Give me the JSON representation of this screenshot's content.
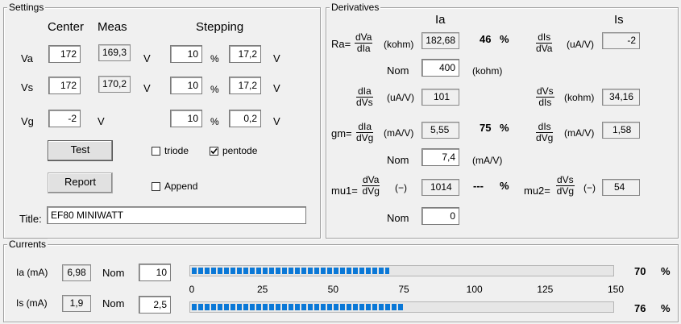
{
  "settings": {
    "legend": "Settings",
    "headers": {
      "center": "Center",
      "meas": "Meas",
      "stepping": "Stepping"
    },
    "rows": [
      {
        "label": "Va",
        "center": "172",
        "meas": "169,3",
        "unit": "V",
        "step_pct": "10",
        "pct_sign": "%",
        "step_val": "17,2",
        "step_unit": "V"
      },
      {
        "label": "Vs",
        "center": "172",
        "meas": "170,2",
        "unit": "V",
        "step_pct": "10",
        "pct_sign": "%",
        "step_val": "17,2",
        "step_unit": "V"
      },
      {
        "label": "Vg",
        "center": "-2",
        "meas": "",
        "unit": "V",
        "step_pct": "10",
        "pct_sign": "%",
        "step_val": "0,2",
        "step_unit": "V"
      }
    ],
    "test_button": "Test",
    "report_button": "Report",
    "triode_label": "triode",
    "triode_checked": false,
    "pentode_label": "pentode",
    "pentode_checked": true,
    "append_label": "Append",
    "append_checked": false,
    "title_label": "Title:",
    "title_value": "EF80 MINIWATT"
  },
  "derivatives": {
    "legend": "Derivatives",
    "col_ia": "Ia",
    "col_is": "Is",
    "ra": {
      "label": "Ra=",
      "num": "dVa",
      "den": "dIa",
      "unit": "(kohm)",
      "value": "182,68",
      "pct": "46",
      "pct_sign": "%",
      "nom_label": "Nom",
      "nom_value": "400",
      "nom_unit": "(kohm)"
    },
    "dis_dva": {
      "num": "dIs",
      "den": "dVa",
      "unit": "(uA/V)",
      "value": "-2"
    },
    "dia_dvs": {
      "num": "dIa",
      "den": "dVs",
      "unit": "(uA/V)",
      "value": "101"
    },
    "dvs_dis": {
      "num": "dVs",
      "den": "dIs",
      "unit": "(kohm)",
      "value": "34,16"
    },
    "gm": {
      "label": "gm=",
      "num": "dIa",
      "den": "dVg",
      "unit": "(mA/V)",
      "value": "5,55",
      "pct": "75",
      "pct_sign": "%",
      "nom_label": "Nom",
      "nom_value": "7,4",
      "nom_unit": "(mA/V)"
    },
    "dis_dvg": {
      "num": "dIs",
      "den": "dVg",
      "unit": "(mA/V)",
      "value": "1,58"
    },
    "mu1": {
      "label": "mu1=",
      "num": "dVa",
      "den": "dVg",
      "unit": "(−)",
      "value": "1014",
      "pct": "---",
      "pct_sign": "%",
      "nom_label": "Nom",
      "nom_value": "0"
    },
    "mu2": {
      "label": "mu2=",
      "num": "dVs",
      "den": "dVg",
      "unit": "(−)",
      "value": "54"
    }
  },
  "currents": {
    "legend": "Currents",
    "ia": {
      "label": "Ia (mA)",
      "value": "6,98",
      "nom_label": "Nom",
      "nom_value": "10",
      "pct": "70",
      "pct_sign": "%",
      "fill_fraction": 0.47
    },
    "is": {
      "label": "Is (mA)",
      "value": "1,9",
      "nom_label": "Nom",
      "nom_value": "2,5",
      "pct": "76",
      "pct_sign": "%",
      "fill_fraction": 0.506
    },
    "scale": [
      "0",
      "25",
      "50",
      "75",
      "100",
      "125",
      "150"
    ],
    "scale_max": 150
  },
  "colors": {
    "bar_fill": "#0a78d7"
  }
}
